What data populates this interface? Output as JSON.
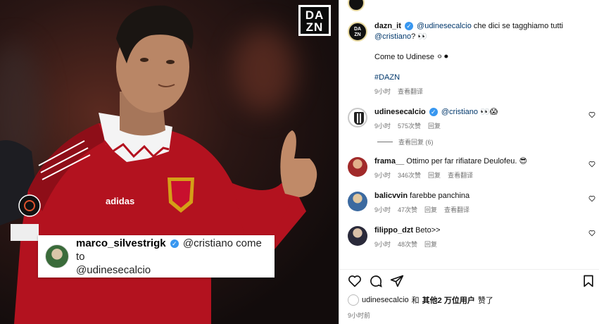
{
  "photo": {
    "logo_line1": "DA",
    "logo_line2": "ZN",
    "caption": {
      "username": "marco_silvestrigk",
      "text_line1": "@cristiano come to",
      "text_line2": "@udinesecalcio"
    }
  },
  "post": {
    "author": "dazn_it",
    "mention": "@udinesecalcio",
    "caption_text": "che dici se tagghiamo tutti",
    "mention2": "@cristiano",
    "emoji1": "? 👀",
    "line2": "Come to Udinese ⚪⚫",
    "hashtag": "#DAZN",
    "time": "9小时",
    "translate": "查看翻译"
  },
  "comments": [
    {
      "user": "udinesecalcio",
      "verified": true,
      "text_mention": "@cristiano",
      "text": "👀😱",
      "time": "9小时",
      "likes": "575次赞",
      "reply": "回复",
      "view_replies": "查看回复 (6)"
    },
    {
      "user": "frama__",
      "verified": false,
      "text": "Ottimo per far rifiatare Deulofeu. 😎",
      "time": "9小时",
      "likes": "346次赞",
      "reply": "回复",
      "translate": "查看翻译"
    },
    {
      "user": "balicvvin",
      "verified": false,
      "text": "farebbe panchina",
      "time": "9小时",
      "likes": "47次赞",
      "reply": "回复",
      "translate": "查看翻译"
    },
    {
      "user": "filippo_dzt",
      "verified": false,
      "text": "Beto>>",
      "time": "9小时",
      "likes": "48次赞",
      "reply": "回复"
    }
  ],
  "likes_line": {
    "user": "udinesecalcio",
    "and": "和",
    "others": "其他2 万位用户",
    "suffix": "赞了"
  },
  "post_time": "9小时前",
  "colors": {
    "verified": "#3897f0",
    "mention": "#00376b",
    "meta": "#737373"
  }
}
